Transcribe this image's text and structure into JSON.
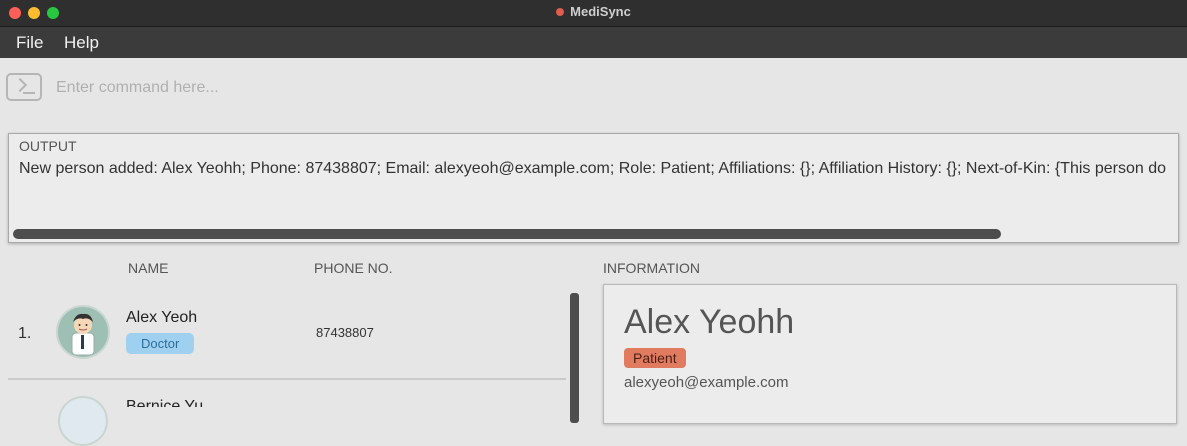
{
  "window": {
    "title": "MediSync"
  },
  "menu": {
    "items": [
      "File",
      "Help"
    ]
  },
  "command": {
    "placeholder": "Enter command here..."
  },
  "output": {
    "label": "OUTPUT",
    "text": "New person added: Alex Yeohh; Phone: 87438807; Email: alexyeoh@example.com; Role: Patient; Affiliations: {}; Affiliation History: {}; Next-of-Kin: {This person do"
  },
  "list": {
    "headers": {
      "name": "NAME",
      "phone": "PHONE NO."
    },
    "rows": [
      {
        "index": "1.",
        "name": "Alex Yeoh",
        "role": "Doctor",
        "phone": "87438807"
      },
      {
        "name_fragment": "Bernice Yu"
      }
    ]
  },
  "info": {
    "header": "INFORMATION",
    "name": "Alex Yeohh",
    "role": "Patient",
    "email": "alexyeoh@example.com"
  },
  "colors": {
    "doctor_badge": "#9fd0f0",
    "patient_badge": "#e07b5f",
    "menubar": "#3b3b3b",
    "background": "#e6e6e6"
  }
}
